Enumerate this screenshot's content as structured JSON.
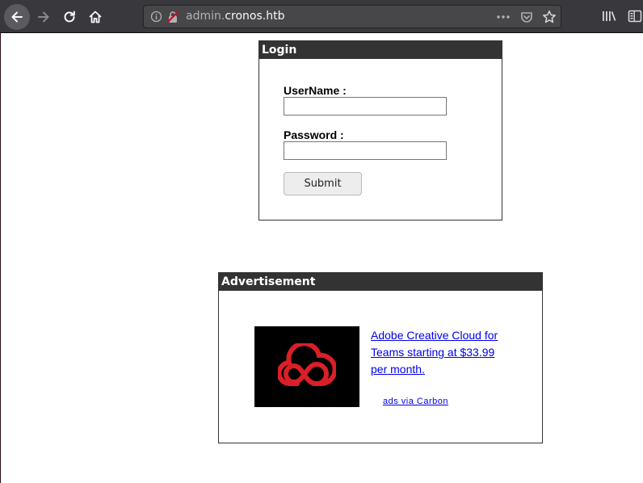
{
  "browser": {
    "url_prefix": "admin.",
    "url_domain": "cronos.htb",
    "colors": {
      "toolbar": "#38383d",
      "urlbar": "#474749",
      "text": "#f9f9fa"
    }
  },
  "login": {
    "title": "Login",
    "username_label": "UserName :",
    "password_label": "Password :",
    "username_value": "",
    "password_value": "",
    "submit_label": "Submit"
  },
  "ad": {
    "title": "Advertisement",
    "link_text": "Adobe Creative Cloud for Teams starting at $33.99 per month.",
    "credit_text": "ads via Carbon",
    "logo_icon": "adobe-creative-cloud-logo",
    "logo_color": "#da1f26"
  }
}
